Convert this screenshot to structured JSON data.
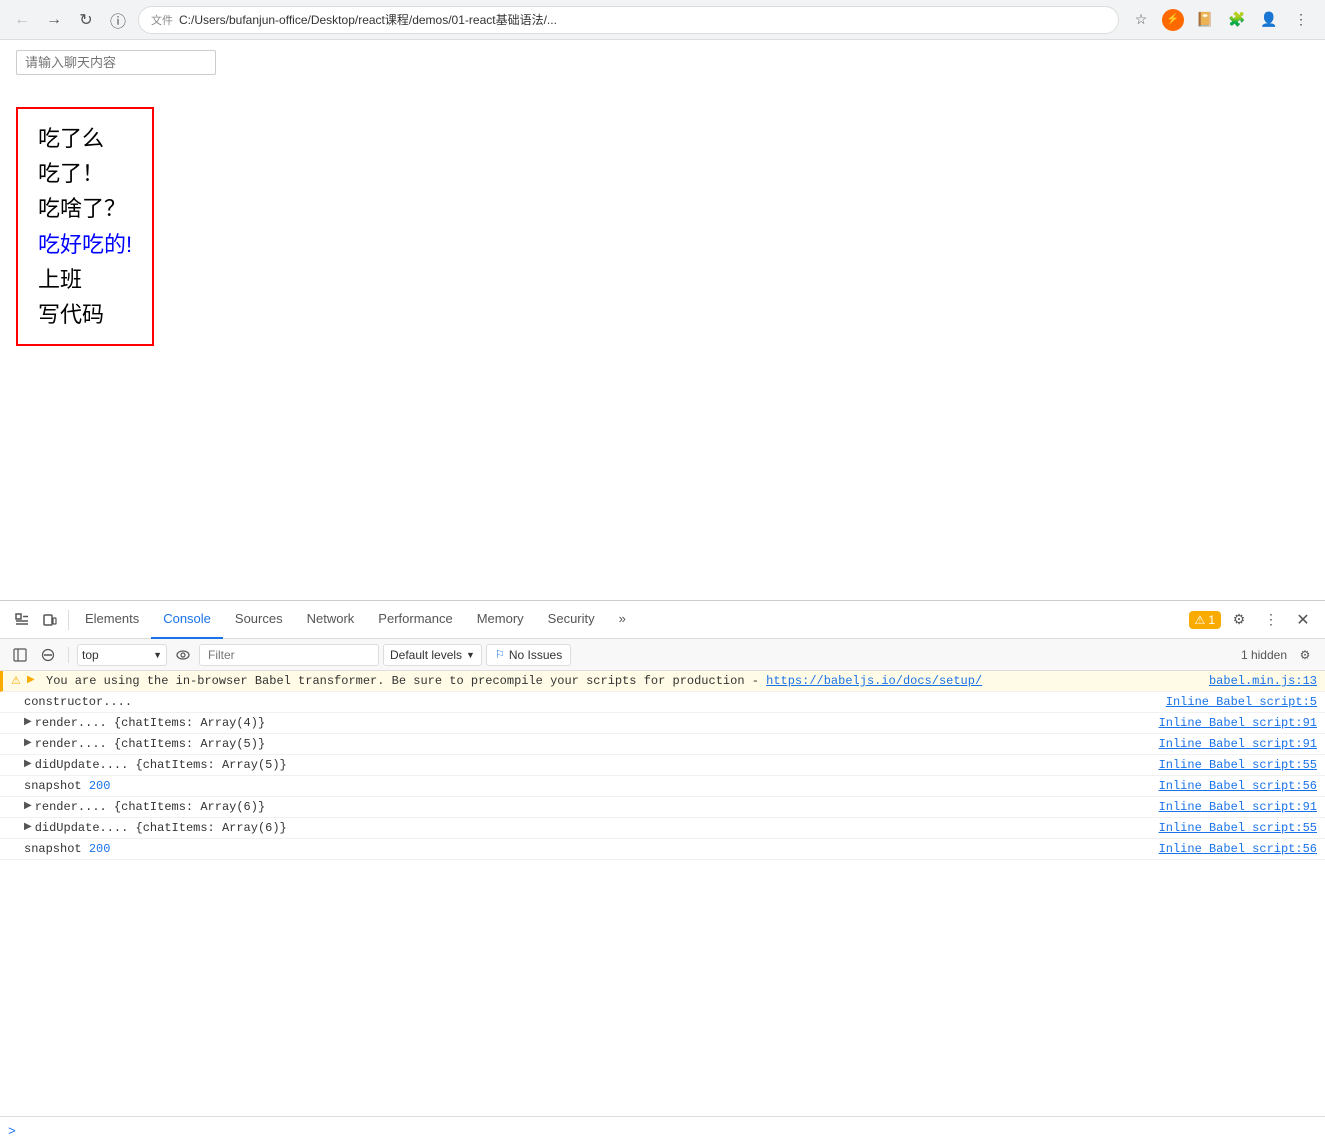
{
  "browser": {
    "back_label": "←",
    "forward_label": "→",
    "reload_label": "↻",
    "info_label": "ℹ",
    "file_label": "文件",
    "url": "C:/Users/bufanjun-office/Desktop/react课程/demos/01-react基础语法/...",
    "bookmark_label": "☆",
    "toolbar_icons": [
      "⚡",
      "📖",
      "🧩",
      "👤",
      "⋮"
    ]
  },
  "page": {
    "input_placeholder": "请输入聊天内容",
    "chat_items": [
      {
        "text": "吃了么",
        "highlight": false
      },
      {
        "text": "吃了！",
        "highlight": false
      },
      {
        "text": "吃啥了？",
        "highlight": false
      },
      {
        "text": "吃好吃的!",
        "highlight": true
      },
      {
        "text": "上班",
        "highlight": false
      },
      {
        "text": "写代码",
        "highlight": false
      }
    ]
  },
  "devtools": {
    "tabs": [
      "Elements",
      "Console",
      "Sources",
      "Network",
      "Performance",
      "Memory",
      "Security"
    ],
    "active_tab": "Console",
    "more_label": "»",
    "warning_count": "1",
    "settings_label": "⚙",
    "more_options_label": "⋮",
    "close_label": "✕"
  },
  "console_toolbar": {
    "clear_label": "🚫",
    "context_value": "top",
    "dropdown_arrow": "▼",
    "eye_label": "👁",
    "filter_placeholder": "Filter",
    "default_levels_label": "Default levels",
    "dropdown_arrow2": "▼",
    "no_issues_label": "No Issues",
    "hidden_label": "1 hidden",
    "settings_label": "⚙"
  },
  "console_rows": [
    {
      "type": "warning",
      "icon": "▶",
      "expandable": true,
      "content": "You are using the in-browser Babel transformer. Be sure to precompile your scripts for production - https://babeljs.io/docs/setup/",
      "link": "https://babeljs.io/docs/setup/",
      "source": "babel.min.js:13"
    },
    {
      "type": "log",
      "icon": "",
      "expandable": false,
      "content": "constructor....",
      "source": "Inline Babel script:5"
    },
    {
      "type": "log",
      "icon": "▶",
      "expandable": true,
      "prefix": "render....  ",
      "content": "{chatItems: Array(4)}",
      "source": "Inline Babel script:91"
    },
    {
      "type": "log",
      "icon": "▶",
      "expandable": true,
      "prefix": "render....  ",
      "content": "{chatItems: Array(5)}",
      "source": "Inline Babel script:91"
    },
    {
      "type": "log",
      "icon": "▶",
      "expandable": true,
      "prefix": "didUpdate....  ",
      "content": "{chatItems: Array(5)}",
      "source": "Inline Babel script:55"
    },
    {
      "type": "log",
      "icon": "",
      "expandable": false,
      "prefix": "snapshot ",
      "content": "200",
      "content_blue": true,
      "source": "Inline Babel script:56"
    },
    {
      "type": "log",
      "icon": "▶",
      "expandable": true,
      "prefix": "render....  ",
      "content": "{chatItems: Array(6)}",
      "source": "Inline Babel script:91"
    },
    {
      "type": "log",
      "icon": "▶",
      "expandable": true,
      "prefix": "didUpdate....  ",
      "content": "{chatItems: Array(6)}",
      "source": "Inline Babel script:55"
    },
    {
      "type": "log",
      "icon": "",
      "expandable": false,
      "prefix": "snapshot ",
      "content": "200",
      "content_blue": true,
      "source": "Inline Babel script:56"
    }
  ],
  "console_input": {
    "prompt": ">"
  }
}
